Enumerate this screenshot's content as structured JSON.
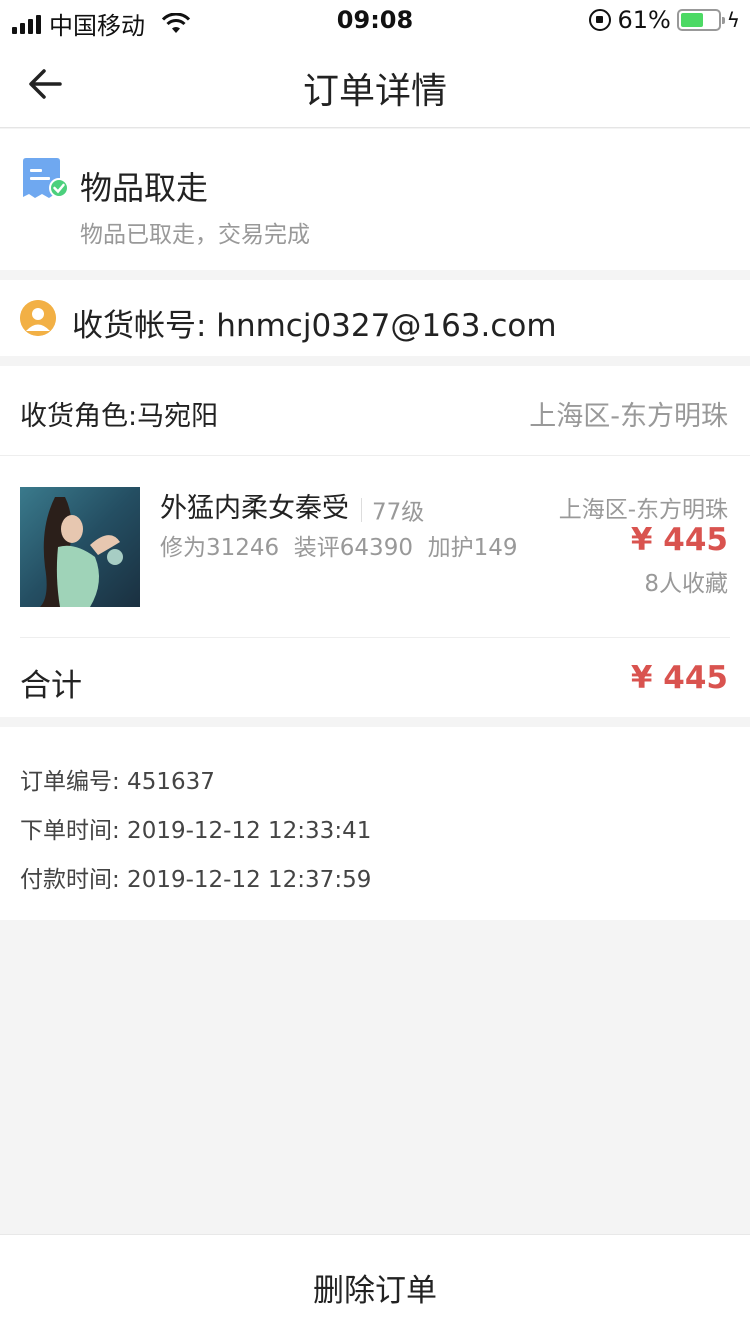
{
  "status_bar": {
    "carrier": "中国移动",
    "time": "09:08",
    "battery_percent": "61%",
    "battery_level": 0.61,
    "battery_color": "#4cd964"
  },
  "nav": {
    "title": "订单详情",
    "back_icon": "arrow-left-icon"
  },
  "order_status": {
    "icon": "receipt-check-icon",
    "title": "物品取走",
    "subtitle": "物品已取走，交易完成"
  },
  "account": {
    "icon": "user-avatar-icon",
    "text": "收货帐号: hnmcj0327@163.com"
  },
  "order": {
    "role_label": "收货角色:马宛阳",
    "role_server": "上海区-东方明珠",
    "item": {
      "name": "外猛内柔女秦受",
      "level": "77级",
      "stats": "修为31246  装评64390  加护149",
      "server": "上海区-东方明珠",
      "price": "¥ 445",
      "favorites": "8人收藏"
    },
    "total_label": "合计",
    "total_price": "¥ 445",
    "accent_color": "#d9534f"
  },
  "info": {
    "order_no": "订单编号: 451637",
    "order_time": "下单时间: 2019-12-12 12:33:41",
    "pay_time": "付款时间: 2019-12-12 12:37:59"
  },
  "footer": {
    "delete_label": "删除订单"
  }
}
